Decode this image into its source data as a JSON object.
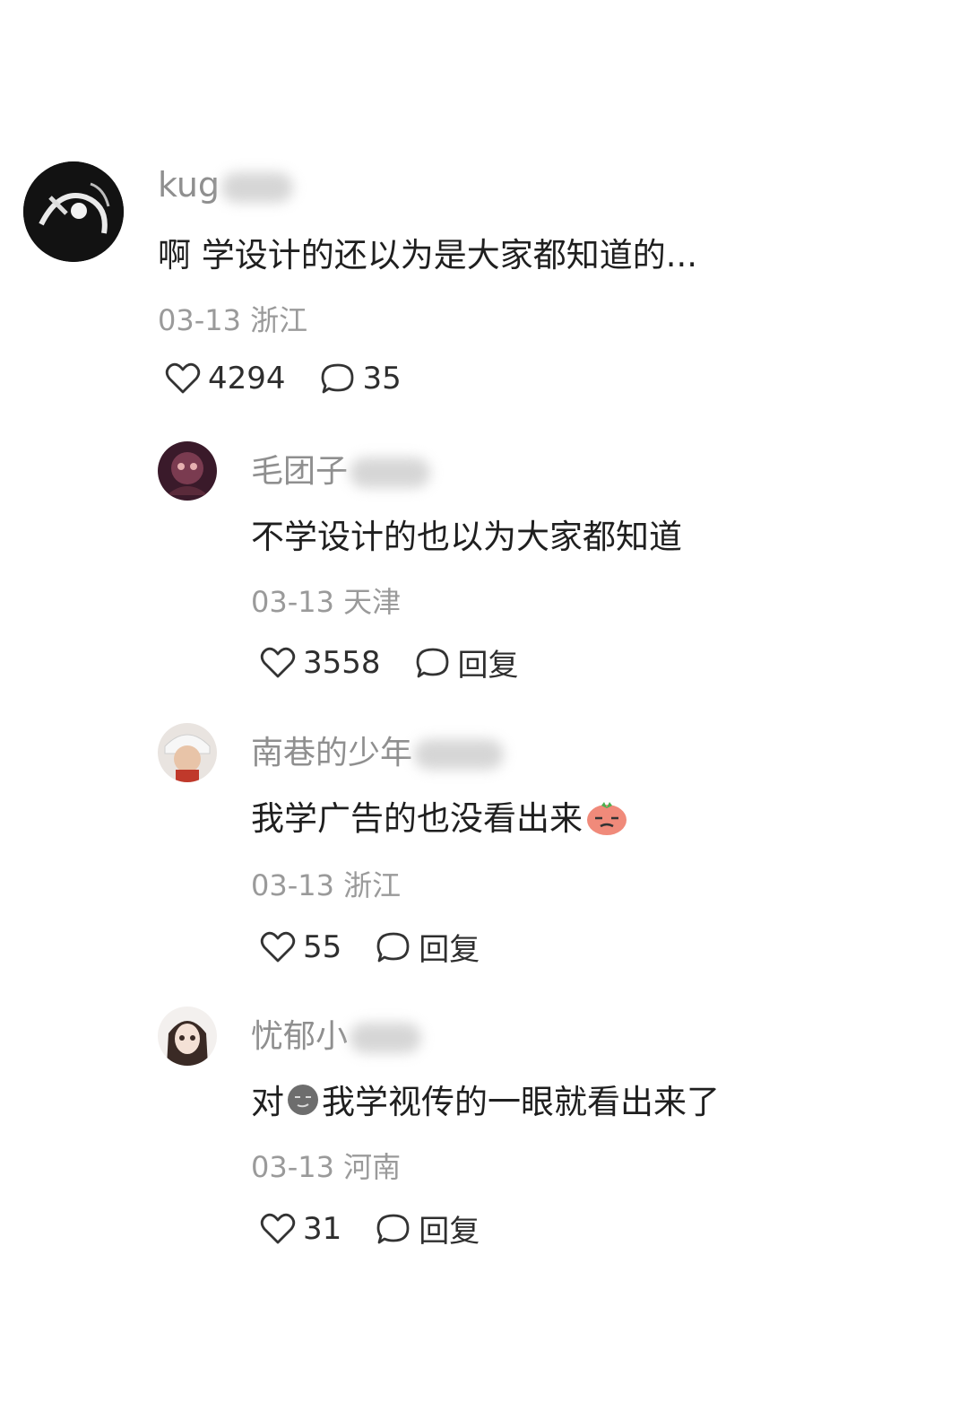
{
  "comments": [
    {
      "username_visible": "kug",
      "text": "啊 学设计的还以为是大家都知道的...",
      "date": "03-13",
      "location": "浙江",
      "likes": "4294",
      "reply_label": "35"
    },
    {
      "username_visible": "毛团子",
      "text": "不学设计的也以为大家都知道",
      "date": "03-13",
      "location": "天津",
      "likes": "3558",
      "reply_label": "回复"
    },
    {
      "username_visible": "南巷的少年",
      "text": "我学广告的也没看出来",
      "date": "03-13",
      "location": "浙江",
      "likes": "55",
      "reply_label": "回复"
    },
    {
      "username_visible": "忧郁小",
      "text_before": "对",
      "text_after": "我学视传的一眼就看出来了",
      "date": "03-13",
      "location": "河南",
      "likes": "31",
      "reply_label": "回复"
    }
  ],
  "icons": {
    "like": "heart-outline-icon",
    "reply": "speech-bubble-outline-icon"
  }
}
